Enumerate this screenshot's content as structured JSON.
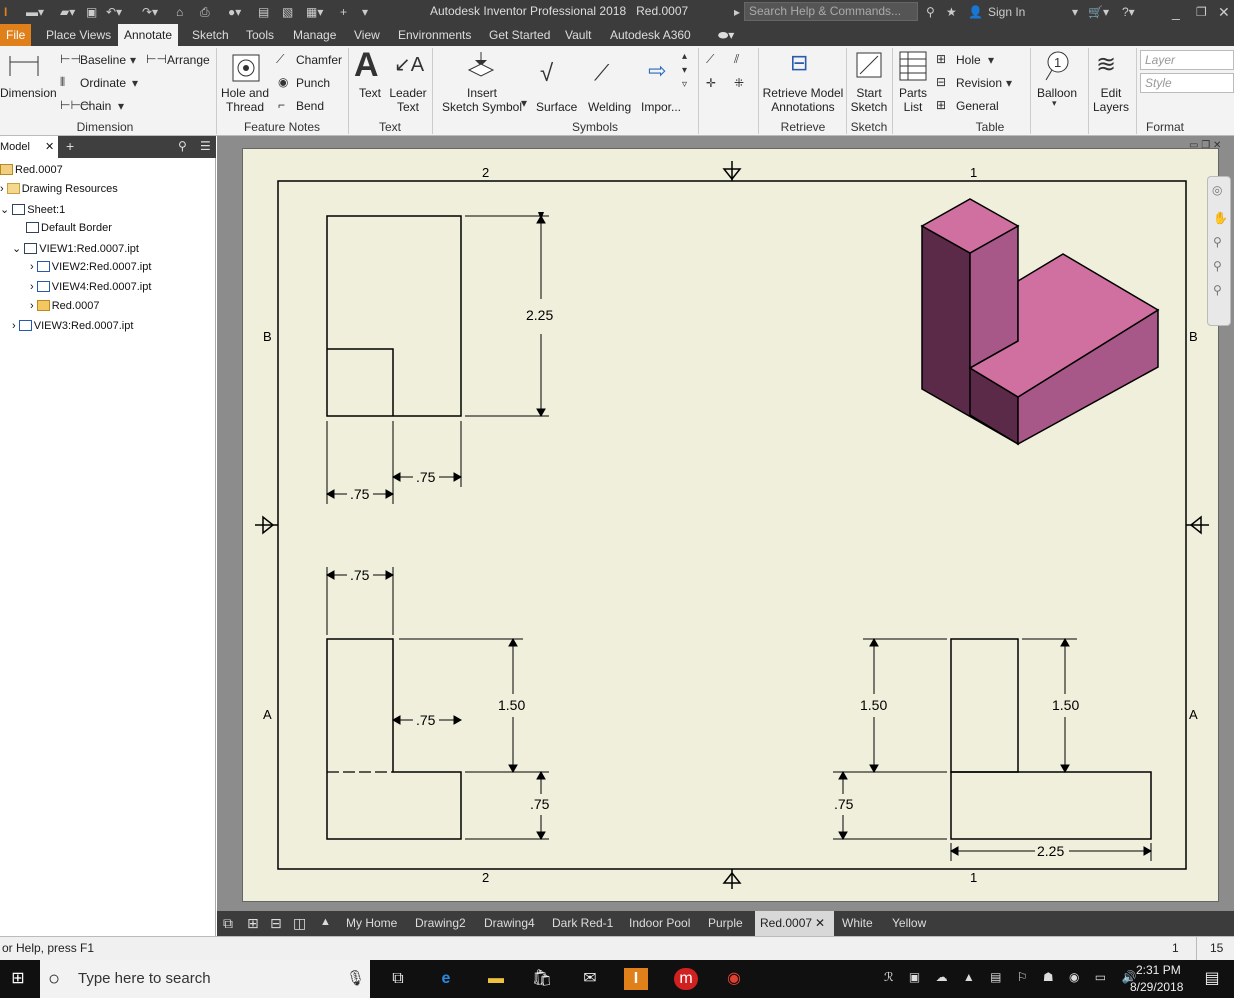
{
  "titlebar": {
    "app_title": "Autodesk Inventor Professional 2018",
    "doc_name": "Red.0007",
    "search_placeholder": "Search Help & Commands...",
    "sign_in": "Sign In"
  },
  "ribbon_tabs": [
    "File",
    "Place Views",
    "Annotate",
    "Sketch",
    "Tools",
    "Manage",
    "View",
    "Environments",
    "Get Started",
    "Vault",
    "Autodesk A360"
  ],
  "active_tab": "Annotate",
  "ribbon": {
    "dimension": {
      "label": "Dimension",
      "main": "Dimension",
      "baseline": "Baseline",
      "ordinate": "Ordinate",
      "chain": "Chain",
      "arrange": "Arrange"
    },
    "feature_notes": {
      "label": "Feature Notes",
      "hole_thread": "Hole and\nThread",
      "chamfer": "Chamfer",
      "punch": "Punch",
      "bend": "Bend"
    },
    "text": {
      "label": "Text",
      "text": "Text",
      "leader_text": "Leader\nText"
    },
    "symbols": {
      "label": "Symbols",
      "insert": "Insert\nSketch Symbol",
      "surface": "Surface",
      "welding": "Welding",
      "import": "Impor..."
    },
    "retrieve": {
      "label": "Retrieve",
      "button": "Retrieve Model\nAnnotations"
    },
    "sketch": {
      "label": "Sketch",
      "button": "Start\nSketch"
    },
    "table": {
      "label": "Table",
      "parts_list": "Parts\nList",
      "hole": "Hole",
      "revision": "Revision",
      "general": "General"
    },
    "balloon": {
      "label": "Balloon"
    },
    "edit_layers": {
      "label": "Edit\nLayers"
    },
    "format": {
      "label": "Format",
      "layer_placeholder": "Layer",
      "style_placeholder": "Style"
    }
  },
  "browser": {
    "tab_label": "Model",
    "items": [
      {
        "label": "Red.0007",
        "indent": 0
      },
      {
        "label": "Drawing Resources",
        "indent": 1
      },
      {
        "label": "Sheet:1",
        "indent": 1
      },
      {
        "label": "Default Border",
        "indent": 2
      },
      {
        "label": "VIEW1:Red.0007.ipt",
        "indent": 2
      },
      {
        "label": "VIEW2:Red.0007.ipt",
        "indent": 3
      },
      {
        "label": "VIEW4:Red.0007.ipt",
        "indent": 3
      },
      {
        "label": "Red.0007",
        "indent": 3
      },
      {
        "label": "VIEW3:Red.0007.ipt",
        "indent": 2
      }
    ]
  },
  "drawing": {
    "zone_top_left": "2",
    "zone_top_right": "1",
    "zone_left_top": "B",
    "zone_left_bottom": "A",
    "zone_right_top": "B",
    "zone_right_bottom": "A",
    "zone_bottom_left": "2",
    "zone_bottom_right": "1",
    "dims": {
      "top_height": "2.25",
      "top_w1": ".75",
      "top_w2": ".75",
      "front_w_top": ".75",
      "front_inner": ".75",
      "front_h_upper": "1.50",
      "front_h_lower": ".75",
      "side_h_left": "1.50",
      "side_h_right": "1.50",
      "side_h_lower": ".75",
      "side_width": "2.25"
    },
    "colors": {
      "iso_top": "#d070a0",
      "iso_front": "#a85888",
      "iso_side": "#5a2a48",
      "sheet": "#efefdc"
    }
  },
  "doc_tabs": [
    "My Home",
    "Drawing2",
    "Drawing4",
    "Dark Red-1",
    "Indoor Pool",
    "Purple",
    "Red.0007",
    "White",
    "Yellow"
  ],
  "active_doc": "Red.0007",
  "status": {
    "help": "or Help, press F1",
    "left_num": "1",
    "right_num": "15"
  },
  "taskbar": {
    "search": "Type here to search",
    "time": "2:31 PM",
    "date": "8/29/2018"
  }
}
